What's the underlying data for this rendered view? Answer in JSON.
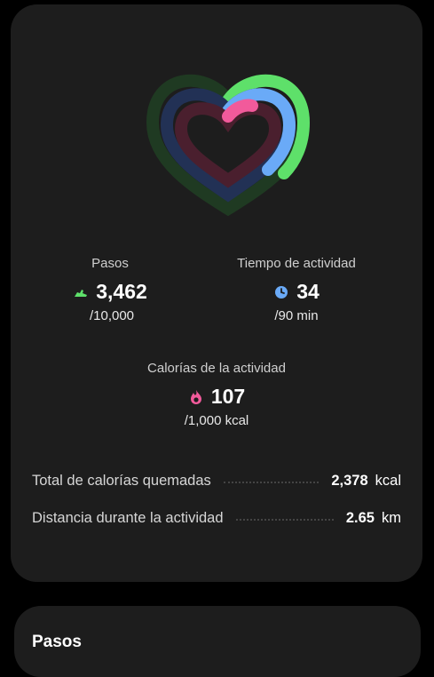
{
  "steps": {
    "label": "Pasos",
    "value": "3,462",
    "goal": "/10,000",
    "icon": "shoe-icon",
    "color": "#5ee06a"
  },
  "active_time": {
    "label": "Tiempo de actividad",
    "value": "34",
    "goal": "/90 min",
    "icon": "clock-icon",
    "color": "#6aaaf7"
  },
  "calories": {
    "label": "Calorías de la actividad",
    "value": "107",
    "goal": "/1,000 kcal",
    "icon": "flame-icon",
    "color": "#f25a9b"
  },
  "summary": [
    {
      "label": "Total de calorías quemadas",
      "value": "2,378",
      "unit": "kcal"
    },
    {
      "label": "Distancia durante la actividad",
      "value": "2.65",
      "unit": "km"
    }
  ],
  "next_card": {
    "title": "Pasos"
  },
  "progress": {
    "steps": 0.3462,
    "active_time": 0.378,
    "calories": 0.107
  }
}
